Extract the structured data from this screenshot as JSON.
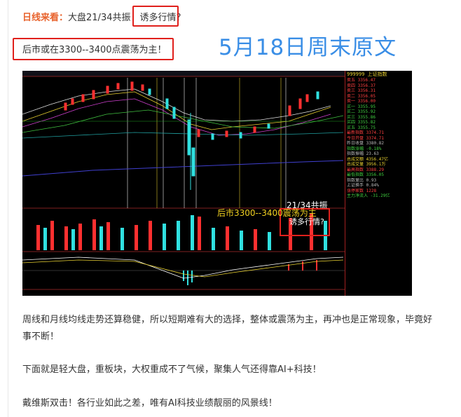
{
  "intro": {
    "head": "日线来看：",
    "text": "大盘21/34共振！",
    "boxed": "诱多行情?"
  },
  "line2": "后市或在3300--3400点震荡为主！",
  "big_title": "5月18日周末原文",
  "chart_image": {
    "annotation_resonance": "21/34共振",
    "annotation_question": "诱多行情?",
    "annotation_range": "后市3300--3400震荡为主",
    "side_panel": {
      "header": "999999 上证指数",
      "rows": [
        {
          "label": "卖五",
          "value": "3356.47"
        },
        {
          "label": "卖四",
          "value": "3356.37"
        },
        {
          "label": "卖三",
          "value": "3356.31"
        },
        {
          "label": "卖二",
          "value": "3356.05"
        },
        {
          "label": "卖一",
          "value": "3356.00"
        },
        {
          "label": "买一",
          "value": "3355.95"
        },
        {
          "label": "买二",
          "value": "3355.92"
        },
        {
          "label": "买三",
          "value": "3355.86"
        },
        {
          "label": "买四",
          "value": "3355.82"
        },
        {
          "label": "买五",
          "value": "3355.75"
        },
        {
          "label": "最新指数",
          "value": "3374.71"
        },
        {
          "label": "今日开盘",
          "value": "3374.71"
        },
        {
          "label": "昨日收盘",
          "value": "3380.82"
        },
        {
          "label": "指数涨幅",
          "value": "-0.18%"
        },
        {
          "label": "指数振幅",
          "value": "23.63"
        },
        {
          "label": "总成交额",
          "value": "4356.47亿"
        },
        {
          "label": "总成交量",
          "value": "3956.1万"
        },
        {
          "label": "最高指数",
          "value": "3388.29"
        },
        {
          "label": "最低指数",
          "value": "3356.05"
        },
        {
          "label": "指数量比",
          "value": "0.93"
        },
        {
          "label": "上证换手",
          "value": "0.84%"
        },
        {
          "label": "涨停家数",
          "value": "1228"
        },
        {
          "label": "主力净流入",
          "value": "-31.29亿"
        }
      ]
    }
  },
  "paragraphs": [
    "周线和月线均线走势还算稳健，所以短期难有大的选择，整体或震荡为主，再冲也是正常现象，毕竟好事不断！",
    "下面就是轻大盘，重板块，大权重成不了气候，聚集人气还得靠AI+科技！",
    "戴维斯双击！各行业如此之差，唯有AI科技业绩靓丽的风景线！"
  ]
}
